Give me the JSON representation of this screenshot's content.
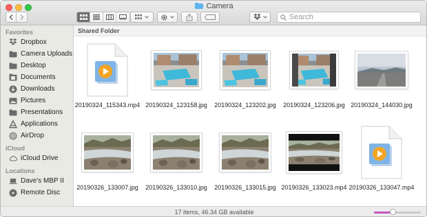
{
  "window": {
    "title": "Camera"
  },
  "toolbar": {
    "search_placeholder": "Search"
  },
  "sidebar": {
    "sections": [
      {
        "heading": "Favorites",
        "items": [
          {
            "label": "Dropbox",
            "icon": "dropbox-icon"
          },
          {
            "label": "Camera Uploads",
            "icon": "folder-icon"
          },
          {
            "label": "Desktop",
            "icon": "folder-icon"
          },
          {
            "label": "Documents",
            "icon": "document-icon"
          },
          {
            "label": "Downloads",
            "icon": "downloads-icon"
          },
          {
            "label": "Pictures",
            "icon": "pictures-icon"
          },
          {
            "label": "Presentations",
            "icon": "folder-icon"
          },
          {
            "label": "Applications",
            "icon": "applications-icon"
          },
          {
            "label": "AirDrop",
            "icon": "airdrop-icon"
          }
        ]
      },
      {
        "heading": "iCloud",
        "items": [
          {
            "label": "iCloud Drive",
            "icon": "cloud-icon"
          }
        ]
      },
      {
        "heading": "Locations",
        "items": [
          {
            "label": "Dave's MBP II",
            "icon": "laptop-icon"
          },
          {
            "label": "Remote Disc",
            "icon": "disc-icon"
          }
        ]
      }
    ]
  },
  "content": {
    "section_header": "Shared Folder",
    "files": [
      {
        "name": "20190324_115343.mp4",
        "kind": "video"
      },
      {
        "name": "20190324_123158.jpg",
        "kind": "pool"
      },
      {
        "name": "20190324_123202.jpg",
        "kind": "pool"
      },
      {
        "name": "20190324_123206.jpg",
        "kind": "pool-balcony"
      },
      {
        "name": "20190324_144030.jpg",
        "kind": "highway"
      },
      {
        "name": "20190326_133007.jpg",
        "kind": "creek"
      },
      {
        "name": "20190326_133010.jpg",
        "kind": "creek"
      },
      {
        "name": "20190326_133015.jpg",
        "kind": "creek"
      },
      {
        "name": "20190326_133023.mp4",
        "kind": "creek-video"
      },
      {
        "name": "20190326_133047.mp4",
        "kind": "video"
      }
    ]
  },
  "status": {
    "text": "17 items, 46.34 GB available",
    "zoom_level": 0.4
  },
  "colors": {
    "accent": "#c455c4",
    "sidebar_bg": "#e8eae3",
    "folder_blue": "#5ab4ef"
  }
}
